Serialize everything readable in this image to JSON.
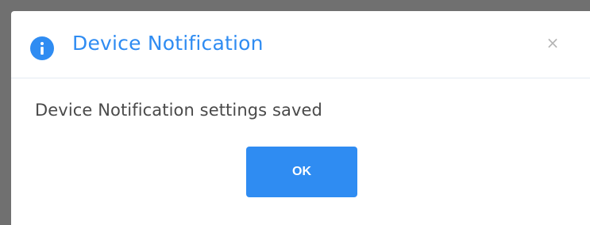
{
  "dialog": {
    "title": "Device Notification",
    "title_icon": "info-icon",
    "close_label": "×",
    "message": "Device Notification settings saved",
    "ok_label": "OK"
  },
  "colors": {
    "accent": "#2f8cf2",
    "message_text": "#4a4a4a",
    "close_icon": "#b5b5b5",
    "backdrop": "#707070"
  }
}
